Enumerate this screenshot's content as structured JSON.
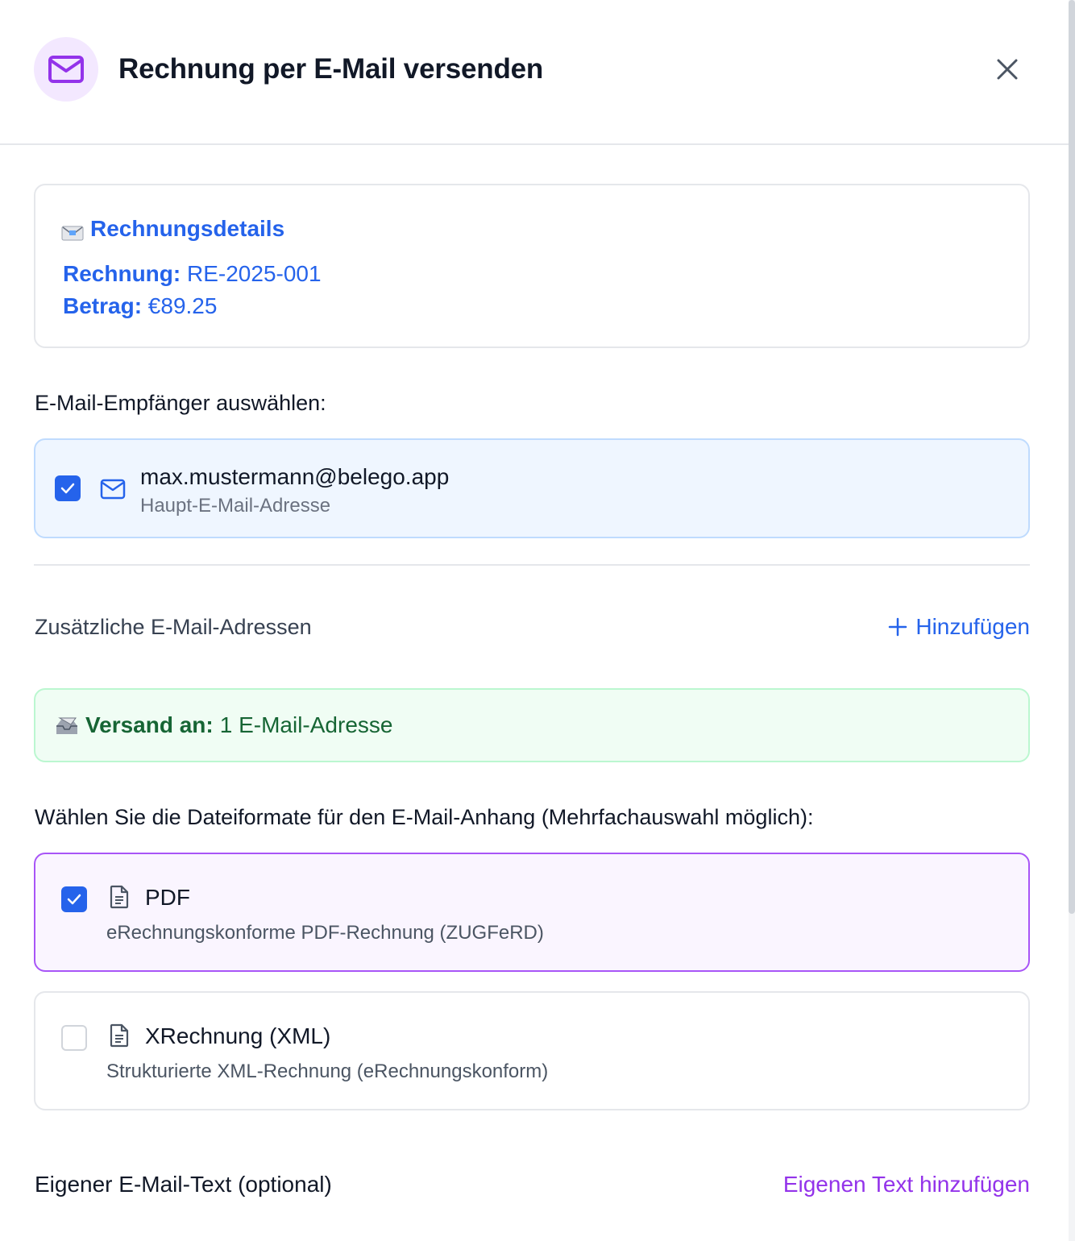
{
  "dialog": {
    "title": "Rechnung per E-Mail versenden",
    "accent_color": "#9333ea",
    "icon": "envelope-icon"
  },
  "details": {
    "title": "Rechnungsdetails",
    "invoice_label": "Rechnung:",
    "invoice_value": "RE-2025-001",
    "amount_label": "Betrag:",
    "amount_value": "€89.25",
    "color": "#2563eb"
  },
  "recipients": {
    "label": "E-Mail-Empfänger auswählen:",
    "items": [
      {
        "email": "max.mustermann@belego.app",
        "subtitle": "Haupt-E-Mail-Adresse",
        "checked": true
      }
    ]
  },
  "additional": {
    "label": "Zusätzliche E-Mail-Adressen",
    "add_label": "Hinzufügen"
  },
  "send_summary": {
    "label": "Versand an:",
    "value": "1 E-Mail-Adresse",
    "color": "#166534"
  },
  "formats": {
    "label": "Wählen Sie die Dateiformate für den E-Mail-Anhang (Mehrfachauswahl möglich):",
    "items": [
      {
        "title": "PDF",
        "subtitle": "eRechnungskonforme PDF-Rechnung (ZUGFeRD)",
        "checked": true
      },
      {
        "title": "XRechnung (XML)",
        "subtitle": "Strukturierte XML-Rechnung (eRechnungskonform)",
        "checked": false
      }
    ]
  },
  "custom_text": {
    "label": "Eigener E-Mail-Text (optional)",
    "link": "Eigenen Text hinzufügen"
  }
}
